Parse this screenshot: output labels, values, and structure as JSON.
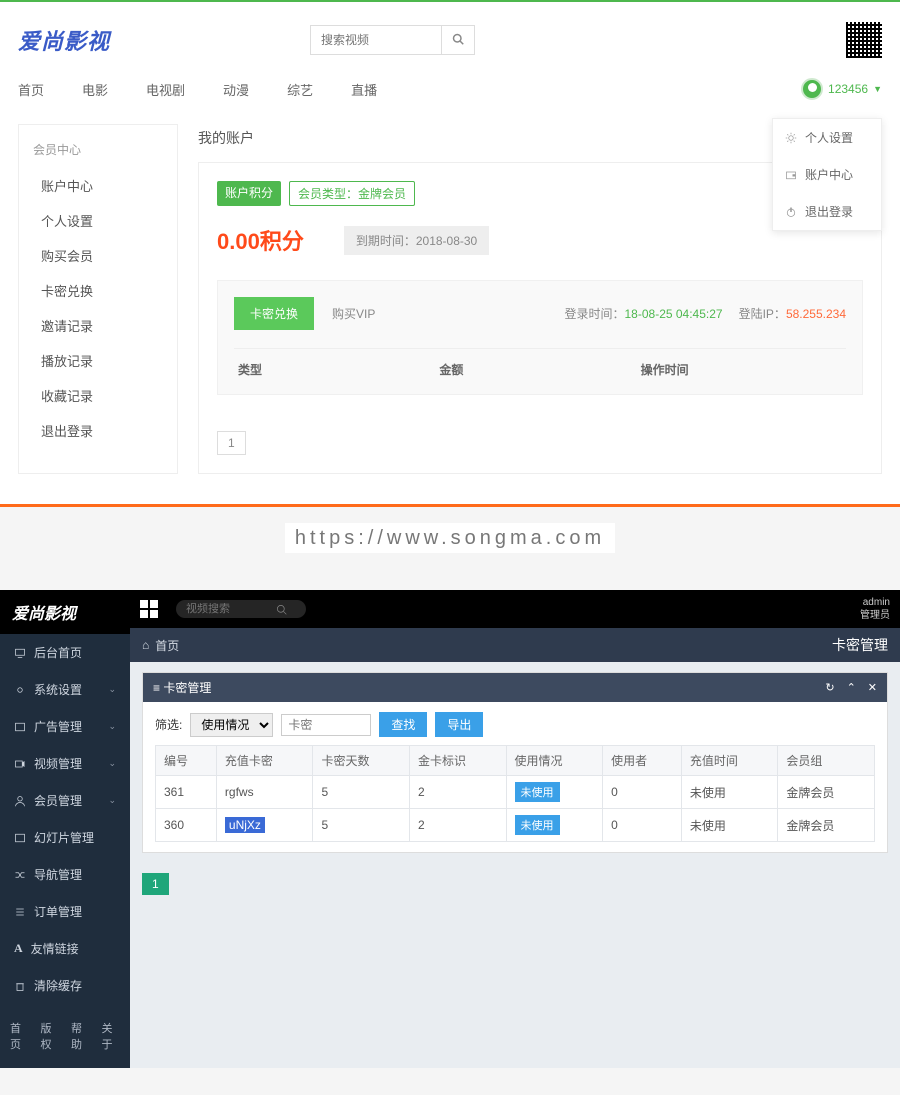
{
  "front": {
    "logo": "爱尚影视",
    "search_placeholder": "搜索视频",
    "nav": [
      "首页",
      "电影",
      "电视剧",
      "动漫",
      "综艺",
      "直播"
    ],
    "username": "123456",
    "dropdown": [
      "个人设置",
      "账户中心",
      "退出登录"
    ],
    "sidebar_heading": "会员中心",
    "sidebar_items": [
      "账户中心",
      "个人设置",
      "购买会员",
      "卡密兑换",
      "邀请记录",
      "播放记录",
      "收藏记录",
      "退出登录"
    ],
    "page_title": "我的账户",
    "badge_points": "账户积分",
    "badge_member": "会员类型：金牌会员",
    "points_value": "0.00积分",
    "expire_label": "到期时间：",
    "expire_value": "2018-08-30",
    "btn_exchange": "卡密兑换",
    "link_buyvip": "购买VIP",
    "login_time_label": "登录时间：",
    "login_time_value": "18-08-25 04:45:27",
    "login_ip_label": "登陆IP：",
    "login_ip_value": "58.255.234",
    "cols": {
      "type": "类型",
      "amount": "金额",
      "optime": "操作时间"
    },
    "page1": "1"
  },
  "url_text": "https://www.songma.com",
  "admin": {
    "logo": "爱尚影视",
    "search_placeholder": "视频搜索",
    "top_user": "admin",
    "top_role": "管理员",
    "crumb_home": "首页",
    "page_title": "卡密管理",
    "side": [
      {
        "label": "后台首页",
        "expand": false
      },
      {
        "label": "系统设置",
        "expand": true
      },
      {
        "label": "广告管理",
        "expand": true
      },
      {
        "label": "视频管理",
        "expand": true
      },
      {
        "label": "会员管理",
        "expand": true
      },
      {
        "label": "幻灯片管理",
        "expand": false
      },
      {
        "label": "导航管理",
        "expand": false
      },
      {
        "label": "订单管理",
        "expand": false
      },
      {
        "label": "友情链接",
        "expand": false
      },
      {
        "label": "清除缓存",
        "expand": false
      }
    ],
    "footer": [
      "首页",
      "版权",
      "帮助",
      "关于"
    ],
    "panel_title": "卡密管理",
    "filter_label": "筛选:",
    "filter_select": "使用情况",
    "filter_input_ph": "卡密",
    "btn_search": "查找",
    "btn_export": "导出",
    "thead": [
      "编号",
      "充值卡密",
      "卡密天数",
      "金卡标识",
      "使用情况",
      "使用者",
      "充值时间",
      "会员组"
    ],
    "rows": [
      {
        "id": "361",
        "code": "rgfws",
        "days": "5",
        "gold": "2",
        "status": "未使用",
        "user": "0",
        "time": "未使用",
        "group": "金牌会员"
      },
      {
        "id": "360",
        "code": "uNjXz",
        "days": "5",
        "gold": "2",
        "status": "未使用",
        "user": "0",
        "time": "未使用",
        "group": "金牌会员"
      }
    ],
    "page_cur": "1"
  }
}
